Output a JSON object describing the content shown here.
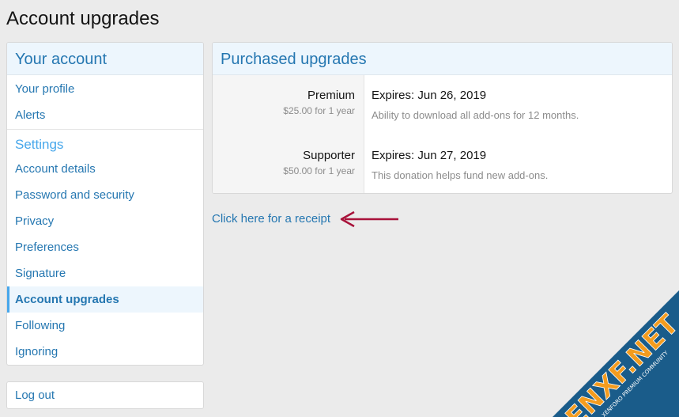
{
  "page": {
    "title": "Account upgrades"
  },
  "sidebar": {
    "header": "Your account",
    "group1": [
      {
        "label": "Your profile"
      },
      {
        "label": "Alerts"
      }
    ],
    "settings_title": "Settings",
    "group2": [
      {
        "label": "Account details"
      },
      {
        "label": "Password and security"
      },
      {
        "label": "Privacy"
      },
      {
        "label": "Preferences"
      },
      {
        "label": "Signature"
      },
      {
        "label": "Account upgrades",
        "active": true
      },
      {
        "label": "Following"
      },
      {
        "label": "Ignoring"
      }
    ],
    "logout": "Log out"
  },
  "main": {
    "header": "Purchased upgrades",
    "upgrades": [
      {
        "name": "Premium",
        "price": "$25.00 for 1 year",
        "expires": "Expires: Jun 26, 2019",
        "description": "Ability to download all add-ons for 12 months."
      },
      {
        "name": "Supporter",
        "price": "$50.00 for 1 year",
        "expires": "Expires: Jun 27, 2019",
        "description": "This donation helps fund new add-ons."
      }
    ],
    "receipt_link": "Click here for a receipt"
  },
  "watermark": {
    "text": "ENXF.NET",
    "subtext": "XENFORO PREMIUM COMMUNITY"
  },
  "colors": {
    "link": "#2577b1",
    "header_bg": "#edf6fd",
    "arrow": "#a8123a",
    "watermark_bg": "#1a5c8a",
    "watermark_text": "#f39c1f"
  }
}
